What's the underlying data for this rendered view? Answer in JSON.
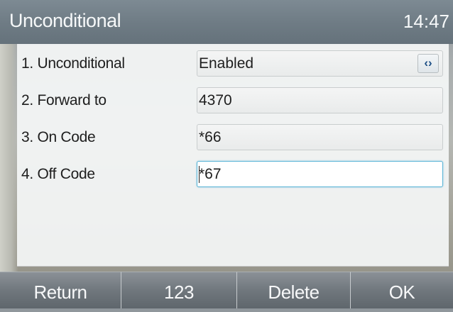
{
  "header": {
    "title": "Unconditional",
    "time": "14:47"
  },
  "form": {
    "rows": [
      {
        "label": "1.  Unconditional",
        "value": "Enabled",
        "has_switch": true
      },
      {
        "label": "2.  Forward to",
        "value": "4370"
      },
      {
        "label": "3.  On Code",
        "value": "*66"
      },
      {
        "label": "4.  Off Code",
        "value": "*67",
        "focused": true
      }
    ],
    "switch_glyph": "‹›"
  },
  "softkeys": [
    "Return",
    "123",
    "Delete",
    "OK"
  ],
  "colors": {
    "focus_border": "#5ab4d6",
    "switch_glyph": "#1d4f86"
  }
}
